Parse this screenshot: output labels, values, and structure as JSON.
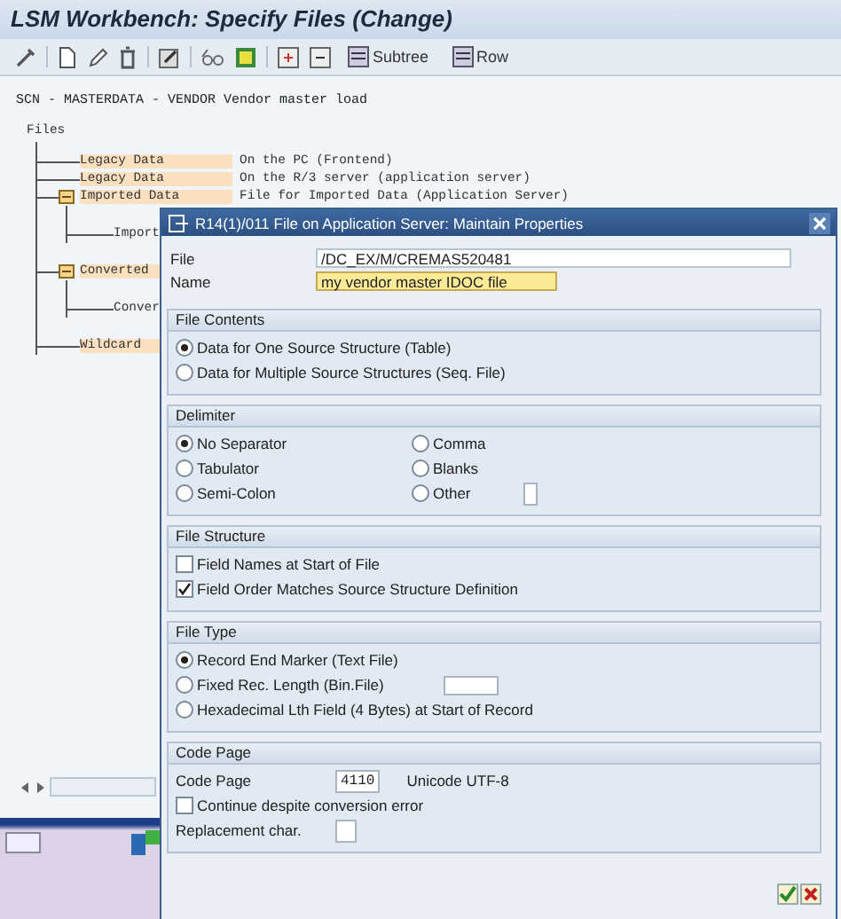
{
  "window": {
    "title": "LSM Workbench: Specify Files (Change)"
  },
  "toolbar_buttons": [
    "Subtree",
    "Row"
  ],
  "heading": "SCN - MASTERDATA - VENDOR Vendor master load",
  "tree": {
    "label": "Files",
    "children": [
      {
        "label": "Legacy Data",
        "description": "On the PC (Frontend)"
      },
      {
        "label": "Legacy Data",
        "description": "On the R/3 server (application server)"
      },
      {
        "label": "Imported Data",
        "description": "File for Imported Data (Application Server)",
        "expanded": true,
        "children": [
          {
            "label": "Import"
          }
        ]
      },
      {
        "label": "Converted",
        "expanded": true,
        "children": [
          {
            "label": "Conver"
          }
        ]
      },
      {
        "label": "Wildcard"
      }
    ]
  },
  "dialog": {
    "title": "R14(1)/011 File on Application Server: Maintain Properties",
    "fields": [
      {
        "label": "File",
        "value": "/DC_EX/M/CREMAS520481",
        "highlighted": false
      },
      {
        "label": "Name",
        "value": "my vendor master IDOC file",
        "highlighted": true
      }
    ],
    "sections": [
      {
        "title": "File Contents",
        "items": [
          {
            "kind": "radio",
            "label": "Data for One Source Structure (Table)",
            "selected": true
          },
          {
            "kind": "radio",
            "label": "Data for Multiple Source Structures (Seq. File)",
            "selected": false
          }
        ]
      },
      {
        "title": "Delimiter",
        "columns": [
          [
            {
              "kind": "radio",
              "label": "No Separator",
              "selected": true
            },
            {
              "kind": "radio",
              "label": "Tabulator",
              "selected": false
            },
            {
              "kind": "radio",
              "label": "Semi-Colon",
              "selected": false
            }
          ],
          [
            {
              "kind": "radio",
              "label": "Comma",
              "selected": false
            },
            {
              "kind": "radio",
              "label": "Blanks",
              "selected": false
            },
            {
              "kind": "radio-field",
              "label": "Other",
              "selected": false
            }
          ]
        ]
      },
      {
        "title": "File Structure",
        "items": [
          {
            "kind": "checkbox",
            "label": "Field Names at Start of File",
            "checked": false
          },
          {
            "kind": "checkbox",
            "label": "Field Order Matches Source Structure Definition",
            "checked": true
          }
        ]
      },
      {
        "title": "File Type",
        "items": [
          {
            "kind": "radio",
            "label": "Record End Marker (Text File)",
            "selected": true
          },
          {
            "kind": "radio-field",
            "label": "Fixed Rec. Length (Bin.File)",
            "selected": false
          },
          {
            "kind": "radio",
            "label": "Hexadecimal Lth Field (4 Bytes) at Start of Record",
            "selected": false
          }
        ]
      },
      {
        "title": "Code Page",
        "items": [
          {
            "kind": "field",
            "label": "Code Page",
            "value": "4110",
            "note": "Unicode UTF-8"
          },
          {
            "kind": "checkbox",
            "label": "Continue despite conversion error",
            "checked": false
          },
          {
            "kind": "field",
            "label": "Replacement char."
          }
        ]
      }
    ]
  }
}
